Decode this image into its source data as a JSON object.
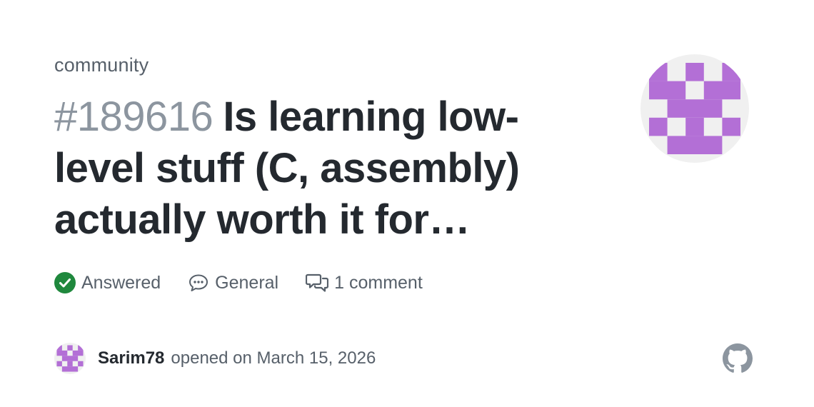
{
  "repo": {
    "name": "community"
  },
  "issue": {
    "number": "#189616",
    "title": "Is learning low-level stuff (C, assembly) actually worth it for…"
  },
  "meta": {
    "status": {
      "label": "Answered",
      "icon": "check-circle-icon",
      "color": "#1f883d"
    },
    "category": {
      "label": "General",
      "icon": "speech-bubble-icon"
    },
    "comments": {
      "label": "1 comment",
      "icon": "comments-icon"
    }
  },
  "author": {
    "name": "Sarim78",
    "opened_text": "opened on March 15, 2026"
  },
  "colors": {
    "identicon": "#b36fd6",
    "identicon_bg": "#f0f0f0",
    "title_text": "#24292f",
    "muted_text": "#57606a",
    "number_text": "#8c959f",
    "github_logo": "#8c959f"
  },
  "icons": {
    "brand": "github-icon"
  }
}
